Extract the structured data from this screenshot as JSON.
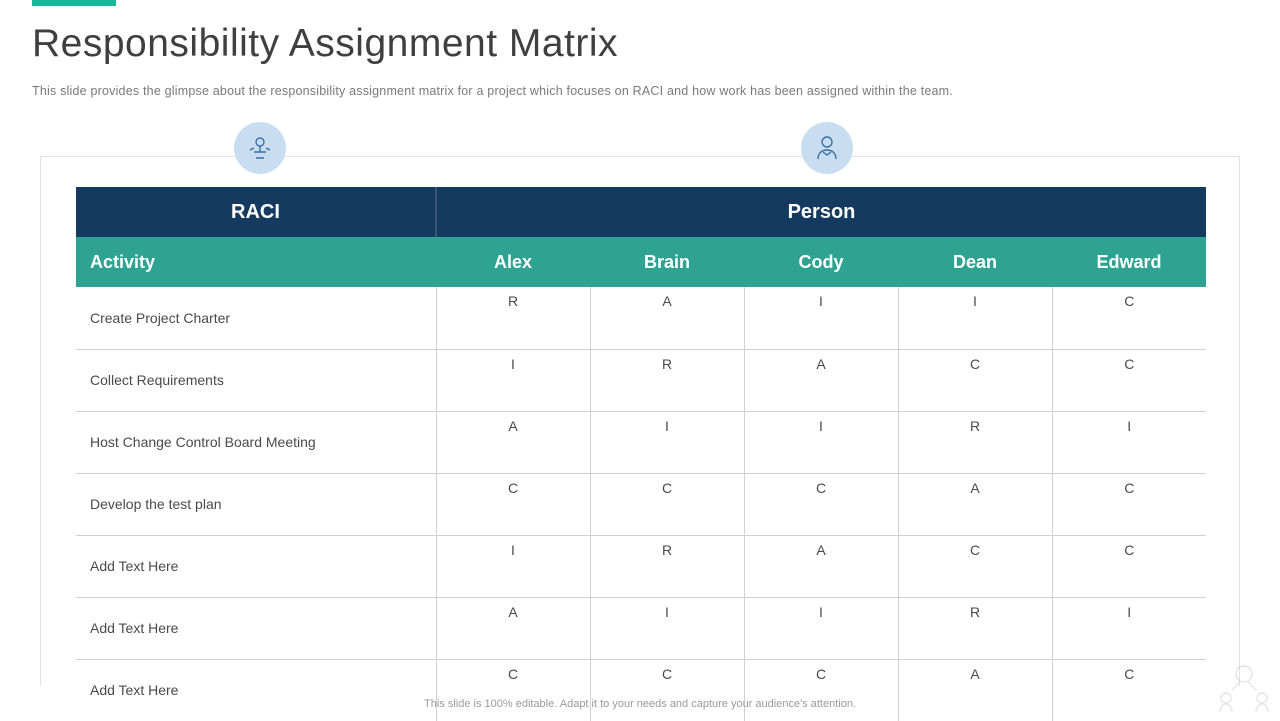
{
  "title": "Responsibility Assignment Matrix",
  "subtitle": "This slide provides the glimpse about the responsibility assignment matrix for a project which focuses on RACI and how work has been assigned within the team.",
  "footer": "This slide is 100% editable. Adapt it to your needs and capture your audience's attention.",
  "headers": {
    "raci": "RACI",
    "person": "Person",
    "activity": "Activity"
  },
  "persons": [
    "Alex",
    "Brain",
    "Cody",
    "Dean",
    "Edward"
  ],
  "rows": [
    {
      "activity": "Create Project Charter",
      "values": [
        "R",
        "A",
        "I",
        "I",
        "C"
      ]
    },
    {
      "activity": "Collect Requirements",
      "values": [
        "I",
        "R",
        "A",
        "C",
        "C"
      ]
    },
    {
      "activity": "Host Change Control Board Meeting",
      "values": [
        "A",
        "I",
        "I",
        "R",
        "I"
      ]
    },
    {
      "activity": "Develop the test plan",
      "values": [
        "C",
        "C",
        "C",
        "A",
        "C"
      ]
    },
    {
      "activity": "Add Text Here",
      "values": [
        "I",
        "R",
        "A",
        "C",
        "C"
      ]
    },
    {
      "activity": "Add Text Here",
      "values": [
        "A",
        "I",
        "I",
        "R",
        "I"
      ]
    },
    {
      "activity": "Add Text Here",
      "values": [
        "C",
        "C",
        "C",
        "A",
        "C"
      ]
    }
  ],
  "chart_data": {
    "type": "table",
    "title": "Responsibility Assignment Matrix",
    "columns": [
      "Activity",
      "Alex",
      "Brain",
      "Cody",
      "Dean",
      "Edward"
    ],
    "rows": [
      [
        "Create Project Charter",
        "R",
        "A",
        "I",
        "I",
        "C"
      ],
      [
        "Collect Requirements",
        "I",
        "R",
        "A",
        "C",
        "C"
      ],
      [
        "Host Change Control Board Meeting",
        "A",
        "I",
        "I",
        "R",
        "I"
      ],
      [
        "Develop the test plan",
        "C",
        "C",
        "C",
        "A",
        "C"
      ],
      [
        "Add Text Here",
        "I",
        "R",
        "A",
        "C",
        "C"
      ],
      [
        "Add Text Here",
        "A",
        "I",
        "I",
        "R",
        "I"
      ],
      [
        "Add Text Here",
        "C",
        "C",
        "C",
        "A",
        "C"
      ]
    ]
  }
}
